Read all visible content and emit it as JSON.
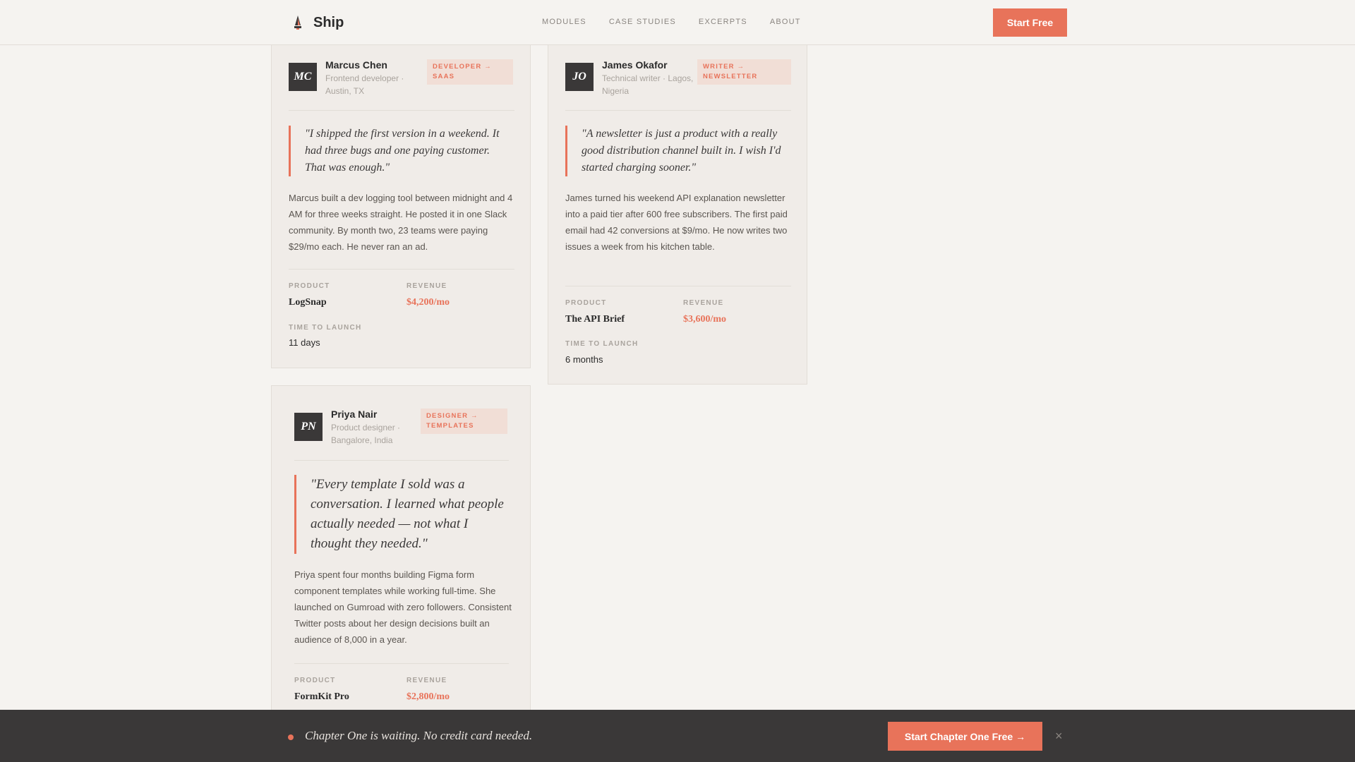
{
  "header": {
    "brand": "Ship",
    "nav": [
      "MODULES",
      "CASE STUDIES",
      "EXCERPTS",
      "ABOUT"
    ],
    "cta": "Start Free"
  },
  "cards": [
    {
      "initials": "MC",
      "name": "Marcus Chen",
      "role_line1": "Frontend developer ·",
      "role_line2": "Austin, TX",
      "tag_line1": "DEVELOPER →",
      "tag_line2": "SAAS",
      "quote": "\"I shipped the first version in a weekend. It had three bugs and one paying customer. That was enough.\"",
      "body": "Marcus built a dev logging tool between midnight and 4 AM for three weeks straight. He posted it in one Slack community. By month two, 23 teams were paying $29/mo each. He never ran an ad.",
      "product_label": "PRODUCT",
      "product": "LogSnap",
      "revenue_label": "REVENUE",
      "revenue": "$4,200/mo",
      "time_label": "TIME TO LAUNCH",
      "time": "11 days"
    },
    {
      "initials": "JO",
      "name": "James Okafor",
      "role_line1": "Technical writer · Lagos,",
      "role_line2": "Nigeria",
      "tag_line1": "WRITER →",
      "tag_line2": "NEWSLETTER",
      "quote": "\"A newsletter is just a product with a really good distribution channel built in. I wish I'd started charging sooner.\"",
      "body": "James turned his weekend API explanation newsletter into a paid tier after 600 free subscribers. The first paid email had 42 conversions at $9/mo. He now writes two issues a week from his kitchen table.",
      "product_label": "PRODUCT",
      "product": "The API Brief",
      "revenue_label": "REVENUE",
      "revenue": "$3,600/mo",
      "time_label": "TIME TO LAUNCH",
      "time": "6 months"
    },
    {
      "initials": "PN",
      "name": "Priya Nair",
      "role_line1": "Product designer ·",
      "role_line2": "Bangalore, India",
      "tag_line1": "DESIGNER →",
      "tag_line2": "TEMPLATES",
      "quote": "\"Every template I sold was a conversation. I learned what people actually needed — not what I thought they needed.\"",
      "body": "Priya spent four months building Figma form component templates while working full-time. She launched on Gumroad with zero followers. Consistent Twitter posts about her design decisions built an audience of 8,000 in a year.",
      "product_label": "PRODUCT",
      "product": "FormKit Pro",
      "revenue_label": "REVENUE",
      "revenue": "$2,800/mo"
    }
  ],
  "banner": {
    "text": "Chapter One is waiting. No credit card needed.",
    "cta": "Start Chapter One Free →",
    "close": "×"
  }
}
